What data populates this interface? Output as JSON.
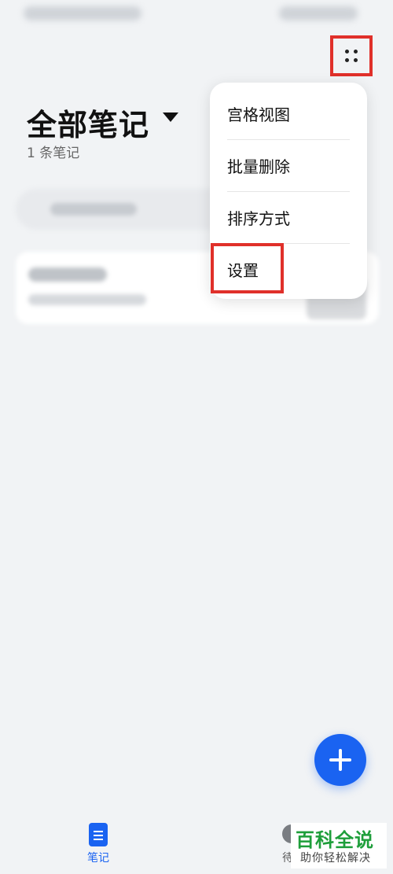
{
  "header": {
    "title": "全部笔记",
    "note_count": "1 条笔记"
  },
  "menu": {
    "items": [
      {
        "label": "宫格视图"
      },
      {
        "label": "批量删除"
      },
      {
        "label": "排序方式"
      },
      {
        "label": "设置"
      }
    ]
  },
  "tabs": {
    "notes_label": "笔记",
    "todo_label": "待"
  },
  "watermark": {
    "title": "百科全说",
    "subtitle": "助你轻松解决"
  },
  "colors": {
    "accent": "#1a63f1",
    "highlight": "#e0302a",
    "watermark_green": "#1e9e3a"
  },
  "icons": {
    "more": "more-dots-icon",
    "dropdown": "caret-down-icon",
    "add": "plus-icon",
    "notes_tab": "document-icon"
  }
}
